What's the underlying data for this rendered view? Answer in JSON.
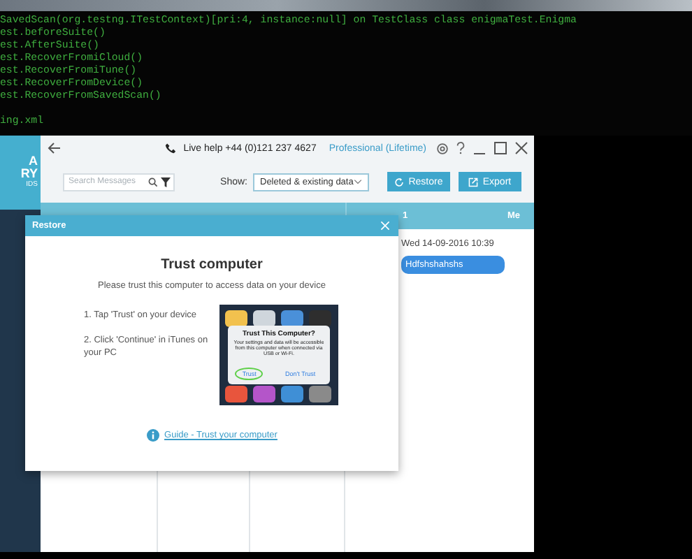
{
  "terminal": {
    "lines": [
      "SavedScan(org.testng.ITestContext)[pri:4, instance:null] on TestClass class enigmaTest.Enigma",
      "est.beforeSuite()",
      "est.AfterSuite()",
      "est.RecoverFromiCloud()",
      "est.RecoverFromiTune()",
      "est.RecoverFromDevice()",
      "est.RecoverFromSavedScan()"
    ],
    "footer_lines": [
      "ing.xml"
    ]
  },
  "sidebar": {
    "logo_lines": [
      "A",
      "RY",
      "IDS"
    ]
  },
  "header": {
    "live_help": "Live help +44 (0)121 237 4627",
    "plan": "Professional (Lifetime)"
  },
  "toolbar": {
    "search": {
      "placeholder": "Search Messages"
    },
    "show_label": "Show:",
    "show_value": "Deleted & existing data",
    "buttons": [
      {
        "label": "Restore",
        "kind": "restore"
      },
      {
        "label": "Export",
        "kind": "export"
      }
    ]
  },
  "conversation": {
    "header_number": "1",
    "header_sender": "Me",
    "messages": [
      {
        "date": "Wed 14-09-2016 10:39",
        "text": "Hdfshshahshs"
      }
    ]
  },
  "dialog": {
    "title": "Restore",
    "heading": "Trust computer",
    "subtitle": "Please trust this computer to access data on your device",
    "steps": [
      "1. Tap 'Trust' on your device",
      "2. Click 'Continue' in iTunes on your PC"
    ],
    "phone_alert": {
      "title": "Trust This Computer?",
      "message": "Your settings and data will be accessible from this computer when connected via USB or Wi-Fi.",
      "buttons": [
        {
          "label": "Trust",
          "selected": true
        },
        {
          "label": "Don't Trust",
          "selected": false
        }
      ]
    },
    "guide_link": "Guide - Trust your computer"
  }
}
